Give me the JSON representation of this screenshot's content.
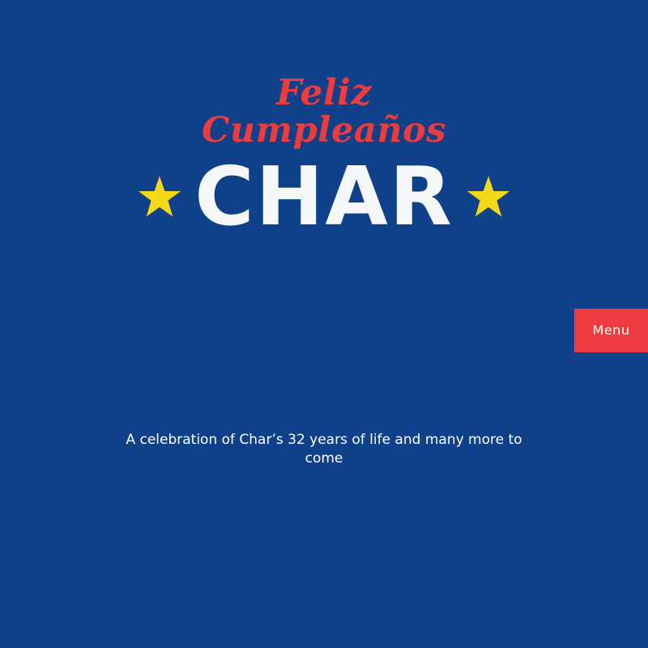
{
  "hero": {
    "line1": "Feliz",
    "line2": "Cumpleaños",
    "name": "CHAR"
  },
  "icons": {
    "left_star": "star-icon",
    "right_star": "star-icon"
  },
  "menu": {
    "label": "Menu"
  },
  "tagline": {
    "text": "A celebration of Char’s 32 years of life and many more to come"
  },
  "colors": {
    "background": "#0f408a",
    "accent_red": "#ef3b3b",
    "star_yellow": "#f5d918",
    "name_white": "#f6f7f8"
  }
}
